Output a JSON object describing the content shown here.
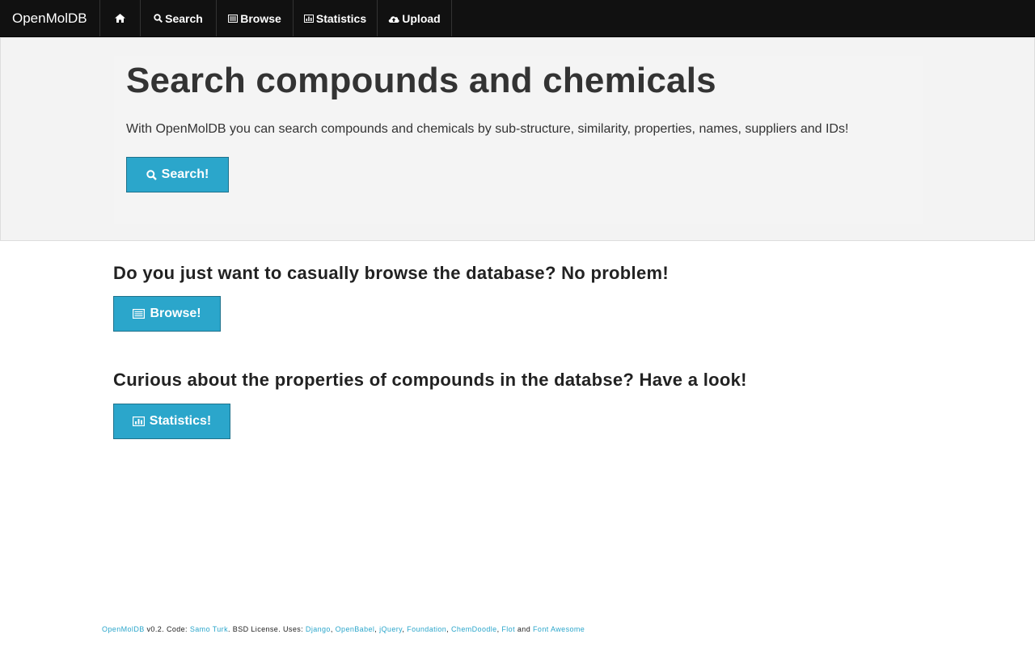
{
  "topbar": {
    "brand": "OpenMolDB",
    "nav": {
      "home_icon": "home-icon",
      "search": "Search",
      "browse": "Browse",
      "statistics": "Statistics",
      "upload": "Upload"
    }
  },
  "hero": {
    "title": "Search compounds and chemicals",
    "lead": "With OpenMolDB you can search compounds and chemicals by sub-structure, similarity, properties, names, suppliers and IDs!",
    "button": "Search!"
  },
  "browse_section": {
    "heading": "Do you just want to casually browse the database? No problem!",
    "button": "Browse!"
  },
  "stats_section": {
    "heading": "Curious about the properties of compounds in the databse? Have a look!",
    "button": "Statistics!"
  },
  "footer": {
    "app_link": "OpenMolDB",
    "version_text": " v0.2. Code: ",
    "author_link": "Samo Turk",
    "license_text": ". BSD License. Uses: ",
    "uses": [
      "Django",
      "OpenBabel",
      "jQuery",
      "Foundation",
      "ChemDoodle",
      "Flot"
    ],
    "separator": ", ",
    "and_text": " and ",
    "last_use": "Font Awesome"
  },
  "colors": {
    "topbar_bg": "#111111",
    "accent": "#2ba6cb",
    "hero_bg": "#f3f3f3"
  }
}
